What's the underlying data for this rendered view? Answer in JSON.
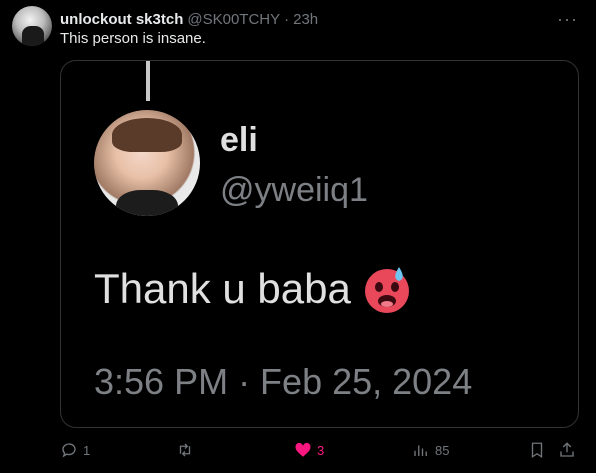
{
  "post": {
    "author_name": "unlockout sk3tch",
    "author_handle": "@SK00TCHY",
    "separator": "·",
    "time": "23h",
    "more_label": "···",
    "text": "This person is insane."
  },
  "quoted": {
    "name": "eli",
    "handle": "@yweiiq1",
    "text": "Thank u baba",
    "emoji": "hot-face-with-sweat-emoji",
    "timestamp": "3:56 PM · Feb 25, 2024"
  },
  "actions": {
    "reply_count": "1",
    "retweet_count": "",
    "like_count": "3",
    "view_count": "85"
  },
  "colors": {
    "background": "#000000",
    "text": "#e7e9ea",
    "muted": "#71767b",
    "like": "#f91880",
    "border": "#2f3336"
  }
}
